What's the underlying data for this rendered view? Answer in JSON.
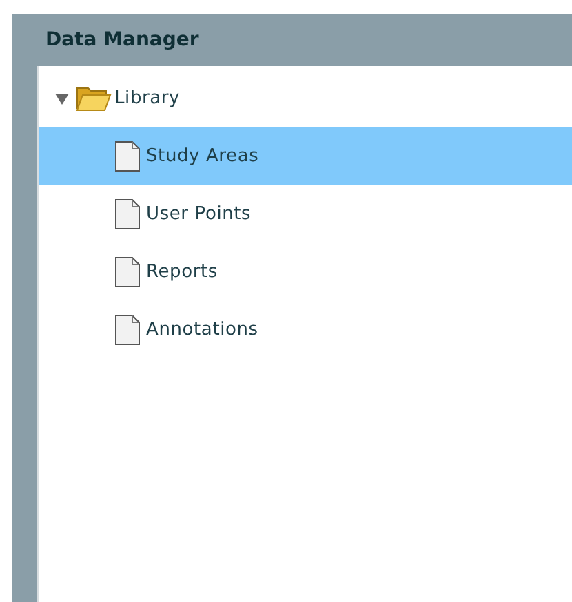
{
  "panel": {
    "title": "Data Manager"
  },
  "tree": [
    {
      "label": "Library",
      "kind": "folder",
      "expanded": true,
      "selected": false,
      "children": [
        {
          "label": "Study Areas",
          "kind": "file",
          "selected": true
        },
        {
          "label": "User Points",
          "kind": "file",
          "selected": false
        },
        {
          "label": "Reports",
          "kind": "file",
          "selected": false
        },
        {
          "label": "Annotations",
          "kind": "file",
          "selected": false
        }
      ]
    }
  ]
}
